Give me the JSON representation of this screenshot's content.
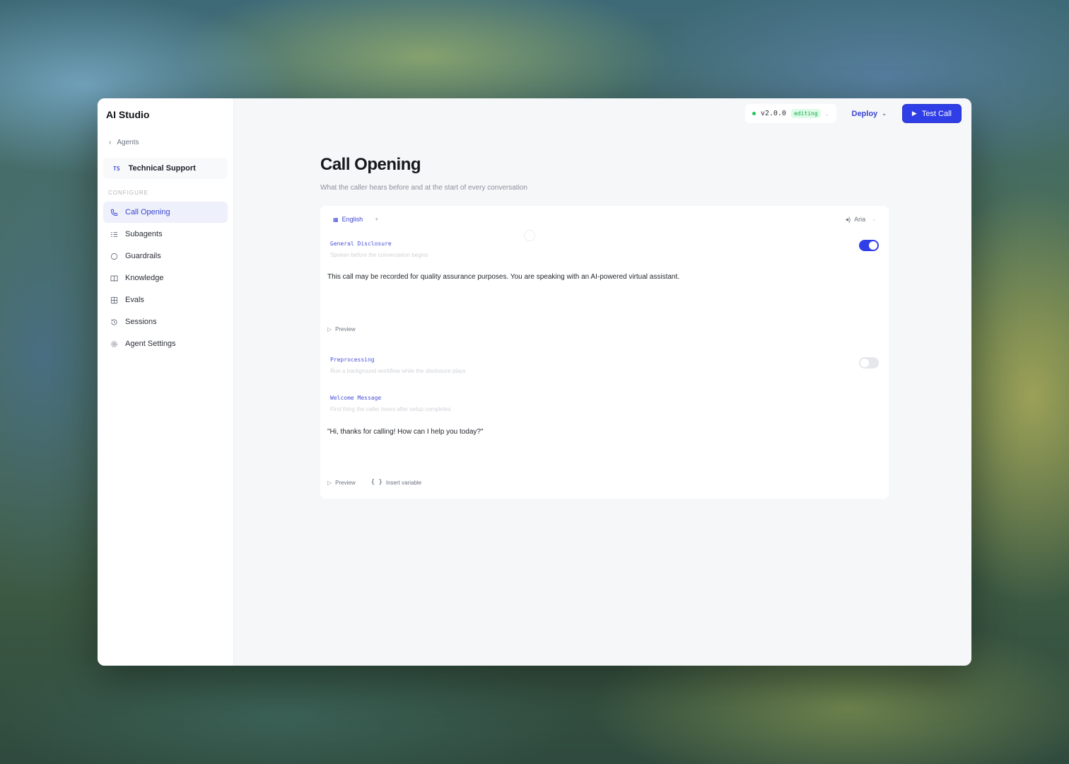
{
  "sidebar": {
    "brand": "AI Studio",
    "back_label": "Agents",
    "agent": {
      "initials": "TS",
      "name": "Technical Support"
    },
    "section_label": "CONFIGURE",
    "items": [
      {
        "label": "Call Opening",
        "icon": "phone-icon"
      },
      {
        "label": "Subagents",
        "icon": "list-icon"
      },
      {
        "label": "Guardrails",
        "icon": "circle-icon"
      },
      {
        "label": "Knowledge",
        "icon": "book-icon"
      },
      {
        "label": "Evals",
        "icon": "grid-icon"
      },
      {
        "label": "Sessions",
        "icon": "history-icon"
      },
      {
        "label": "Agent Settings",
        "icon": "gear-icon"
      }
    ],
    "active_item": "Call Opening"
  },
  "topbar": {
    "version": "v2.0.0",
    "version_status": "editing",
    "deploy_label": "Deploy",
    "test_call_label": "Test Call"
  },
  "page": {
    "title": "Call Opening",
    "subtitle": "What the caller hears before and at the start of every conversation"
  },
  "card": {
    "language": "English",
    "add_language": "+",
    "voice": "Aria",
    "general_disclosure": {
      "label": "General Disclosure",
      "description": "Spoken before the conversation begins",
      "enabled": true,
      "text": "This call may be recorded for quality assurance purposes. You are speaking with an AI-powered virtual assistant.",
      "preview_label": "Preview"
    },
    "preprocessing": {
      "label": "Preprocessing",
      "description": "Run a background workflow while the disclosure plays",
      "enabled": false
    },
    "welcome_message": {
      "label": "Welcome Message",
      "description": "First thing the caller hears after setup completes",
      "text": "\"Hi, thanks for calling! How can I help you today?\"",
      "preview_label": "Preview",
      "insert_variable_label": "Insert variable",
      "insert_variable_symbol": "{ }"
    }
  },
  "colors": {
    "accent": "#2f3ee6",
    "active_nav_bg": "#eef0fb",
    "status_green": "#22c55e"
  }
}
